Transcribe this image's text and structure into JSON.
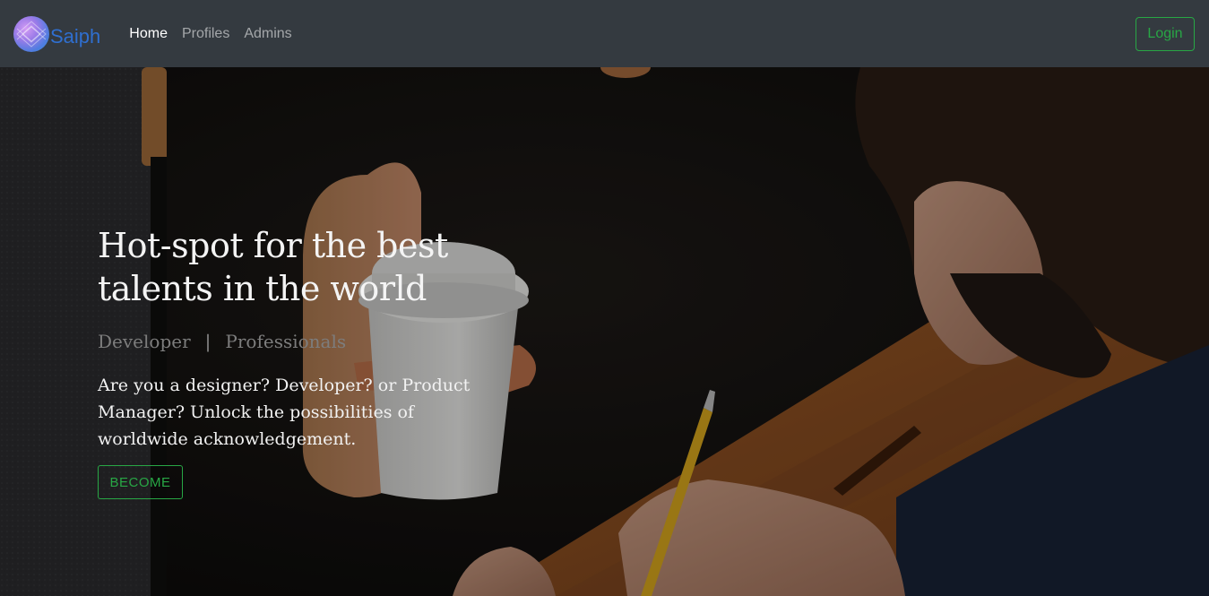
{
  "nav": {
    "brand_text": "Saiph",
    "links": [
      {
        "label": "Home",
        "active": true
      },
      {
        "label": "Profiles",
        "active": false
      },
      {
        "label": "Admins",
        "active": false
      }
    ],
    "login_label": "Login"
  },
  "hero": {
    "title": "Hot-spot for the best talents in the world",
    "roles": [
      "Developer",
      "Professionals"
    ],
    "role_separator": "|",
    "description": "Are you a designer? Developer? or Product Manager? Unlock the possibilities of worldwide acknowledgement.",
    "cta_label": "BECOME",
    "background_image": "man-writing-with-coffee-cup-icon"
  },
  "colors": {
    "navbar_bg": "#343a40",
    "brand_blue": "#2f6fd0",
    "accent_green": "#28a745",
    "nav_link_muted": "rgba(255,255,255,0.55)"
  }
}
